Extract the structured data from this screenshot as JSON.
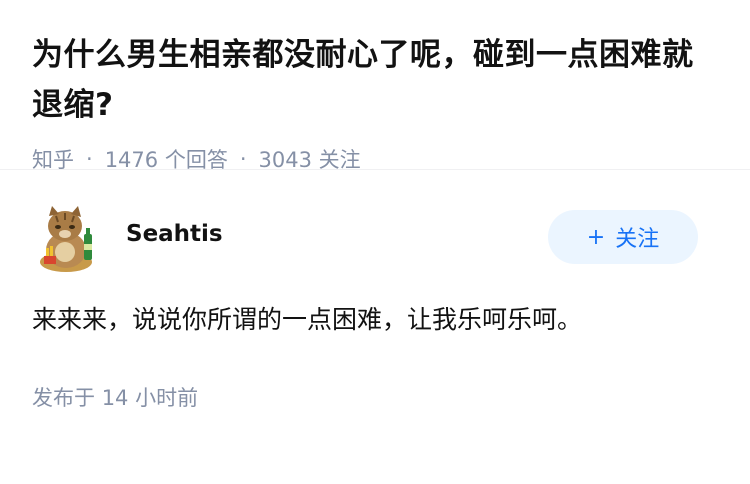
{
  "question": {
    "title": "为什么男生相亲都没耐心了呢，碰到一点困难就退缩?",
    "source": "知乎",
    "answer_count": "1476",
    "answer_label": "个回答",
    "follow_count": "3043",
    "follow_label": "关注"
  },
  "answer": {
    "author": {
      "name": "Seahtis",
      "avatar_icon": "cat-with-bottle-avatar-icon"
    },
    "follow_button": {
      "icon": "plus-icon",
      "label": "关注"
    },
    "content": "来来来，说说你所谓的一点困难，让我乐呵乐呵。",
    "published_label": "发布于",
    "published_time": "14 小时前"
  },
  "colors": {
    "meta_gray": "#8590a6",
    "accent_blue": "#1772f6",
    "follow_bg": "#ebf5ff"
  }
}
